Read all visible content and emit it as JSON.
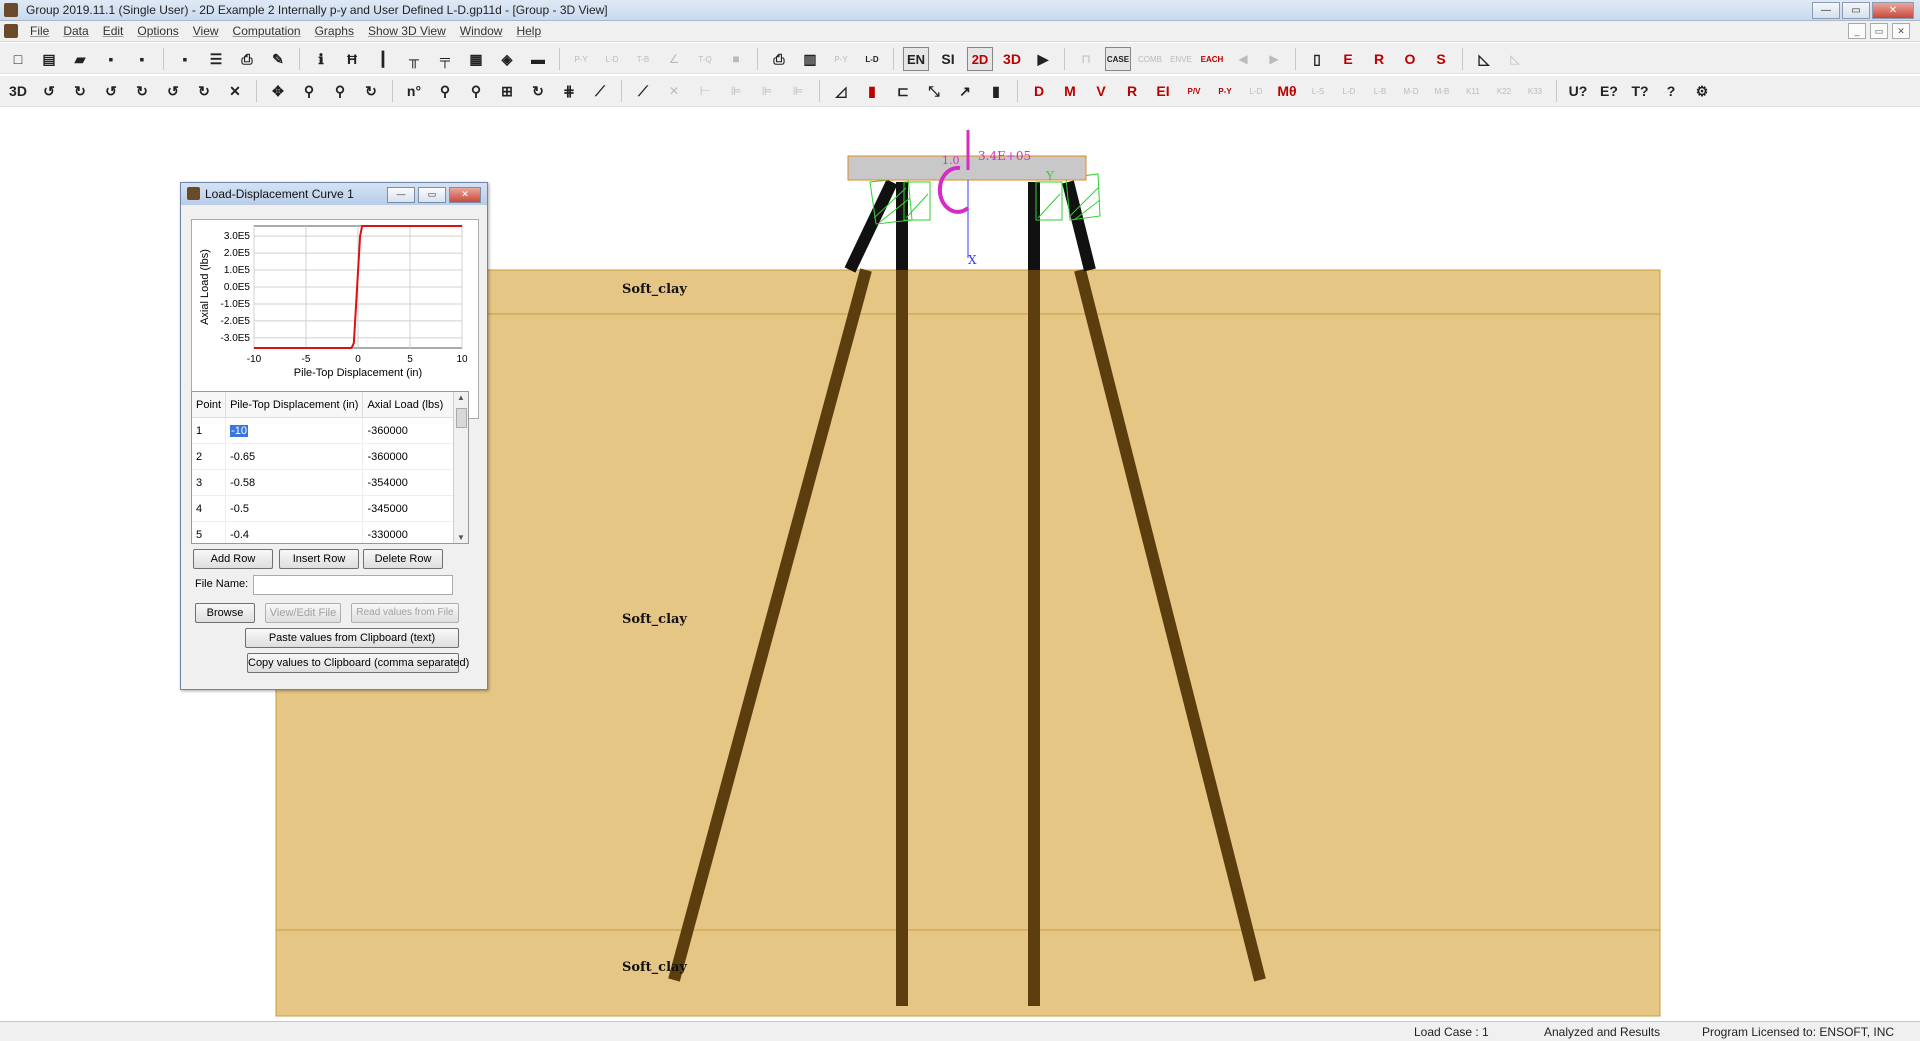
{
  "window": {
    "title": "Group 2019.11.1 (Single User) - 2D Example 2 Internally p-y and  User Defined L-D.gp11d - [Group - 3D View]"
  },
  "menu": {
    "items": [
      "File",
      "Data",
      "Edit",
      "Options",
      "View",
      "Computation",
      "Graphs",
      "Show 3D View",
      "Window",
      "Help"
    ]
  },
  "toolbar1": {
    "tools": [
      {
        "name": "new-file-icon",
        "glyph": "□"
      },
      {
        "name": "new-template-icon",
        "glyph": "▤"
      },
      {
        "name": "open-folder-icon",
        "glyph": "▰"
      },
      {
        "name": "save-icon",
        "glyph": "▪"
      },
      {
        "name": "save-as-icon",
        "glyph": "▪"
      },
      {
        "name": "save-green-icon",
        "glyph": "▪"
      },
      {
        "name": "text-output-icon",
        "glyph": "☰"
      },
      {
        "name": "print-icon",
        "glyph": "⎙"
      },
      {
        "name": "edit-data-icon",
        "glyph": "✎"
      },
      {
        "name": "info-icon",
        "glyph": "ℹ"
      },
      {
        "name": "pile-cap-icon",
        "glyph": "Ħ"
      },
      {
        "name": "pile-icon",
        "glyph": "┃"
      },
      {
        "name": "piles-icon",
        "glyph": "╥"
      },
      {
        "name": "pile-section-icon",
        "glyph": "╤"
      },
      {
        "name": "soil-icon",
        "glyph": "▦"
      },
      {
        "name": "load-icon",
        "glyph": "◈"
      },
      {
        "name": "color-bar-icon",
        "glyph": "▬"
      },
      {
        "name": "py-icon",
        "glyph": "P-Y",
        "dis": true
      },
      {
        "name": "ld-icon",
        "glyph": "L-D",
        "dis": true
      },
      {
        "name": "tb-icon",
        "glyph": "T-B",
        "dis": true
      },
      {
        "name": "curve-icon",
        "glyph": "∠",
        "dis": true
      },
      {
        "name": "tq-icon",
        "glyph": "T-Q",
        "dis": true
      },
      {
        "name": "grey-block-icon",
        "glyph": "■",
        "dis": true
      },
      {
        "name": "printer-icon",
        "glyph": "⎙"
      },
      {
        "name": "ipile-icon",
        "glyph": "▥"
      },
      {
        "name": "py-table-icon",
        "glyph": "P-Y",
        "dis": true
      },
      {
        "name": "ld-table-icon",
        "glyph": "L-D"
      },
      {
        "name": "en-units-button",
        "glyph": "EN",
        "box": true
      },
      {
        "name": "si-units-button",
        "glyph": "SI"
      },
      {
        "name": "view-2d-button",
        "glyph": "2D",
        "box": true,
        "red": true
      },
      {
        "name": "view-3d-button",
        "glyph": "3D",
        "red": true
      },
      {
        "name": "run-analysis-icon",
        "glyph": "▶"
      },
      {
        "name": "load-case-icon",
        "glyph": "⊓",
        "dis": true
      },
      {
        "name": "case-icon",
        "glyph": "CASE",
        "box": true
      },
      {
        "name": "comb-icon",
        "glyph": "COMB",
        "dis": true
      },
      {
        "name": "envelope-icon",
        "glyph": "ENVE",
        "dis": true
      },
      {
        "name": "each-icon",
        "glyph": "EACH",
        "red": true
      },
      {
        "name": "previous-icon",
        "glyph": "◀",
        "dis": true
      },
      {
        "name": "next-icon",
        "glyph": "▶",
        "dis": true
      },
      {
        "name": "report-icon",
        "glyph": "▯"
      },
      {
        "name": "report-e-icon",
        "glyph": "E",
        "red": true
      },
      {
        "name": "report-r-icon",
        "glyph": "R",
        "red": true
      },
      {
        "name": "report-o-icon",
        "glyph": "O",
        "red": true
      },
      {
        "name": "report-s-icon",
        "glyph": "S",
        "red": true
      },
      {
        "name": "graph-icon",
        "glyph": "◺"
      },
      {
        "name": "graph-disabled-icon",
        "glyph": "◺",
        "dis": true
      }
    ]
  },
  "toolbar2": {
    "tools": [
      {
        "name": "3d-view-icon",
        "glyph": "3D"
      },
      {
        "name": "rotate-x-icon",
        "glyph": "↺"
      },
      {
        "name": "rotate-neg-x-icon",
        "glyph": "↻"
      },
      {
        "name": "rotate-y-icon",
        "glyph": "↺"
      },
      {
        "name": "rotate-neg-y-icon",
        "glyph": "↻"
      },
      {
        "name": "rotate-z-icon",
        "glyph": "↺"
      },
      {
        "name": "rotate-neg-z-icon",
        "glyph": "↻"
      },
      {
        "name": "reset-rotation-icon",
        "glyph": "✕"
      },
      {
        "name": "pan-icon",
        "glyph": "✥"
      },
      {
        "name": "pin-icon",
        "glyph": "⚲"
      },
      {
        "name": "zoom-icon",
        "glyph": "⚲"
      },
      {
        "name": "rotate-free-icon",
        "glyph": "↻"
      },
      {
        "name": "node-number-icon",
        "glyph": "n°"
      },
      {
        "name": "pile-number-icon",
        "glyph": "⚲"
      },
      {
        "name": "label-icon",
        "glyph": "⚲"
      },
      {
        "name": "grid-icon",
        "glyph": "⊞"
      },
      {
        "name": "refresh-icon",
        "glyph": "↻"
      },
      {
        "name": "mesh-icon",
        "glyph": "⋕"
      },
      {
        "name": "measure-icon",
        "glyph": "⟋"
      },
      {
        "name": "ruler-icon",
        "glyph": "⟋"
      },
      {
        "name": "cross-icon",
        "glyph": "✕",
        "dis": true
      },
      {
        "name": "spring-icon",
        "glyph": "⊢",
        "dis": true
      },
      {
        "name": "springs-icon",
        "glyph": "⊫",
        "dis": true
      },
      {
        "name": "springs2-icon",
        "glyph": "⊫",
        "dis": true
      },
      {
        "name": "springs3-icon",
        "glyph": "⊫",
        "dis": true
      },
      {
        "name": "slope-icon",
        "glyph": "◿"
      },
      {
        "name": "color-map-icon",
        "glyph": "▮",
        "red": true
      },
      {
        "name": "section-icon",
        "glyph": "⊏"
      },
      {
        "name": "deflection-icon",
        "glyph": "⤡"
      },
      {
        "name": "arrow-load-icon",
        "glyph": "↗"
      },
      {
        "name": "scale-icon",
        "glyph": "▮"
      },
      {
        "name": "d-graph-icon",
        "glyph": "D",
        "red": true
      },
      {
        "name": "m-graph-icon",
        "glyph": "M",
        "red": true
      },
      {
        "name": "v-graph-icon",
        "glyph": "V",
        "red": true
      },
      {
        "name": "r-graph-icon",
        "glyph": "R",
        "red": true
      },
      {
        "name": "ei-graph-icon",
        "glyph": "EI",
        "red": true
      },
      {
        "name": "pv-graph-icon",
        "glyph": "P/V",
        "red": true
      },
      {
        "name": "py-graph-icon",
        "glyph": "P-Y",
        "red": true
      },
      {
        "name": "ld-graph-icon",
        "glyph": "L-D",
        "dis": true
      },
      {
        "name": "mo-graph-icon",
        "glyph": "Mθ",
        "red": true
      },
      {
        "name": "ls-crp-icon",
        "glyph": "L-S",
        "dis": true
      },
      {
        "name": "ld-crp-icon",
        "glyph": "L-D",
        "dis": true
      },
      {
        "name": "lb-crp-icon",
        "glyph": "L-B",
        "dis": true
      },
      {
        "name": "md-crp-icon",
        "glyph": "M-D",
        "dis": true
      },
      {
        "name": "mb-crp-icon",
        "glyph": "M-B",
        "dis": true
      },
      {
        "name": "k11-crp-icon",
        "glyph": "K11",
        "dis": true
      },
      {
        "name": "k22-crp-icon",
        "glyph": "K22",
        "dis": true
      },
      {
        "name": "k33-crp-icon",
        "glyph": "K33",
        "dis": true
      },
      {
        "name": "help-u-icon",
        "glyph": "U?"
      },
      {
        "name": "help-e-icon",
        "glyph": "E?"
      },
      {
        "name": "help-t-icon",
        "glyph": "T?"
      },
      {
        "name": "help-icon",
        "glyph": "?"
      },
      {
        "name": "update-icon",
        "glyph": "⚙"
      }
    ]
  },
  "scene": {
    "soil_layer_labels": [
      "Soft_clay",
      "Soft_clay",
      "Soft_clay"
    ],
    "load_labels": [
      "1.0",
      "3.4E+05"
    ],
    "axis_labels": {
      "x": "X",
      "y": "Y"
    },
    "colors": {
      "soil": "#e6c685",
      "soil_line": "#c89b3c",
      "pile": "#5c3e0e",
      "pile_top": "#111111",
      "cap": "#c8c8c8",
      "cap_border": "#e08a1e",
      "load": "#d42cc4",
      "axis": "#3a3aff",
      "spring": "#2fd12f"
    }
  },
  "dialog": {
    "title": "Load-Displacement Curve 1",
    "chart_data": {
      "type": "line",
      "xlabel": "Pile-Top Displacement (in)",
      "ylabel": "Axial Load (lbs)",
      "xlim": [
        -10,
        10
      ],
      "ylim": [
        -3.6,
        3.6
      ],
      "x_ticks": [
        "-10",
        "-5",
        "0",
        "5",
        "10"
      ],
      "y_ticks": [
        "3.0E5",
        "2.0E5",
        "1.0E5",
        "0.0E5",
        "-1.0E5",
        "-2.0E5",
        "-3.0E5"
      ],
      "x": [
        -10,
        -0.65,
        -0.58,
        -0.5,
        -0.4,
        0.2,
        0.4,
        10
      ],
      "y": [
        -3.6,
        -3.6,
        -3.54,
        -3.45,
        -3.3,
        3.0,
        3.6,
        3.6
      ],
      "color": "#dd1111"
    },
    "table": {
      "headers": [
        "Point",
        "Pile-Top Displacement (in)",
        "Axial Load (lbs)"
      ],
      "rows": [
        [
          "1",
          "-10",
          "-360000"
        ],
        [
          "2",
          "-0.65",
          "-360000"
        ],
        [
          "3",
          "-0.58",
          "-354000"
        ],
        [
          "4",
          "-0.5",
          "-345000"
        ],
        [
          "5",
          "-0.4",
          "-330000"
        ]
      ]
    },
    "buttons": {
      "add_row": "Add Row",
      "insert_row": "Insert Row",
      "delete_row": "Delete Row",
      "browse": "Browse",
      "view_edit_file": "View/Edit File",
      "read_values": "Read values from File",
      "paste_values": "Paste values from  Clipboard (text)",
      "copy_values": "Copy values to Clipboard (comma separated)"
    },
    "file_name_label": "File Name:",
    "file_name_value": ""
  },
  "statusbar": {
    "load_case": "Load Case : 1",
    "status": "Analyzed and Results",
    "license": "Program Licensed to: ENSOFT, INC"
  }
}
